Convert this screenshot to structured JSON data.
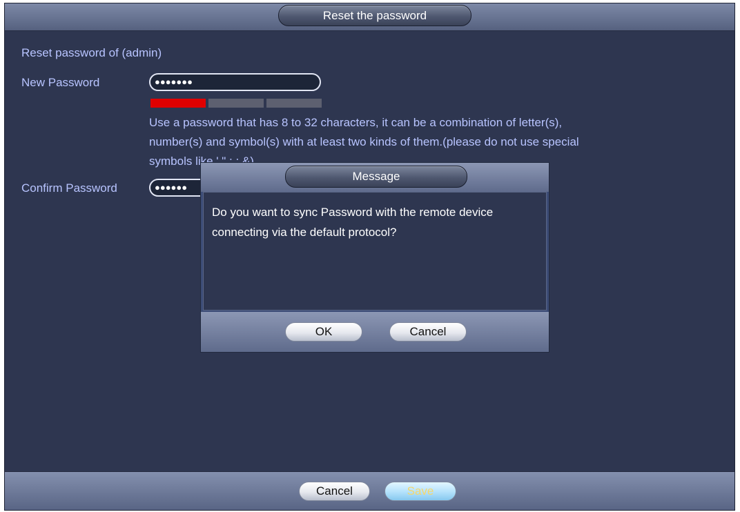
{
  "window": {
    "title": "Reset the password",
    "subtitle": "Reset password of (admin)"
  },
  "form": {
    "new_password_label": "New Password",
    "new_password_value": "●●●●●●●",
    "confirm_password_label": "Confirm Password",
    "confirm_password_value": "●●●●●●",
    "strength_level": 1,
    "strength_segments": 3,
    "strength_colors": {
      "active": "#e00000",
      "inactive": "#5d6070"
    },
    "help_line_1": "Use a password that has 8 to 32 characters, it can be a combination of letter(s),",
    "help_line_2": "number(s) and symbol(s) with at least two kinds of them.(please do not use special",
    "help_line_3": "symbols like ' \" ; : &)"
  },
  "dialog": {
    "title": "Message",
    "message_line_1": "Do you want to sync Password with the remote device",
    "message_line_2": "connecting via the default protocol?",
    "ok_label": "OK",
    "cancel_label": "Cancel"
  },
  "footer": {
    "cancel_label": "Cancel",
    "save_label": "Save"
  },
  "colors": {
    "background": "#2e3650",
    "label_text": "#b8c4ff",
    "save_text": "#f6d76a"
  }
}
